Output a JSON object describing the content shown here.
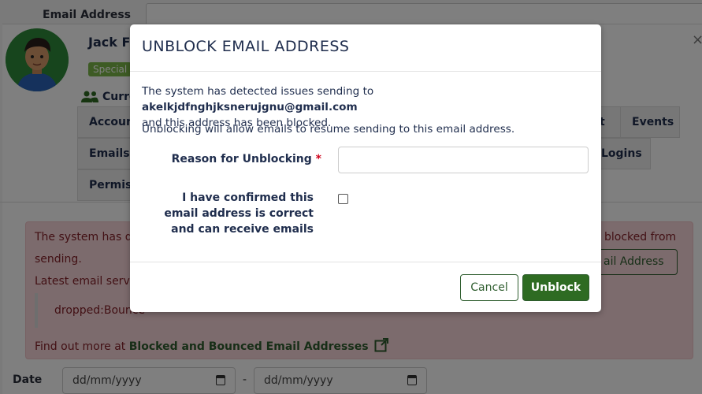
{
  "background": {
    "email_address_label": "Email Address",
    "user_name": "Jack F",
    "badge": "Special",
    "current_label": "Curre",
    "tabs": {
      "account": "Accoun",
      "emails": "Emails",
      "permissions": "Permiss",
      "t": "t",
      "events": "Events",
      "logins": "Logins"
    },
    "alert": {
      "line1_start": "The system has de",
      "line1_end": "blocked from",
      "line2": "sending.",
      "line3": "Latest email serve",
      "quote": "dropped:Bounce",
      "button_label": "ail Address",
      "more_prefix": "Find out more at ",
      "more_link": "Blocked and Bounced Email Addresses"
    },
    "date_label": "Date",
    "date_from_placeholder": "dd/mm/yyyy",
    "date_to_placeholder": "dd/mm/yyyy",
    "date_separator": "-"
  },
  "modal": {
    "title": "UNBLOCK EMAIL ADDRESS",
    "message_prefix": "The system has detected issues sending to ",
    "email": "akelkjdfnghjksnerujgnu@gmail.com",
    "message_suffix": "and this address has been blocked.",
    "message2": "Unblocking will allow emails to resume sending to this email address.",
    "reason_label": "Reason for Unblocking",
    "required_marker": "*",
    "reason_value": "",
    "confirm_label": "I have confirmed this email address is correct and can receive emails",
    "confirm_checked": false,
    "cancel_label": "Cancel",
    "unblock_label": "Unblock"
  },
  "colors": {
    "primary": "#2e6b22",
    "alert_bg": "#f8d7da",
    "alert_text": "#842029",
    "title_text": "#1f2d4d"
  }
}
